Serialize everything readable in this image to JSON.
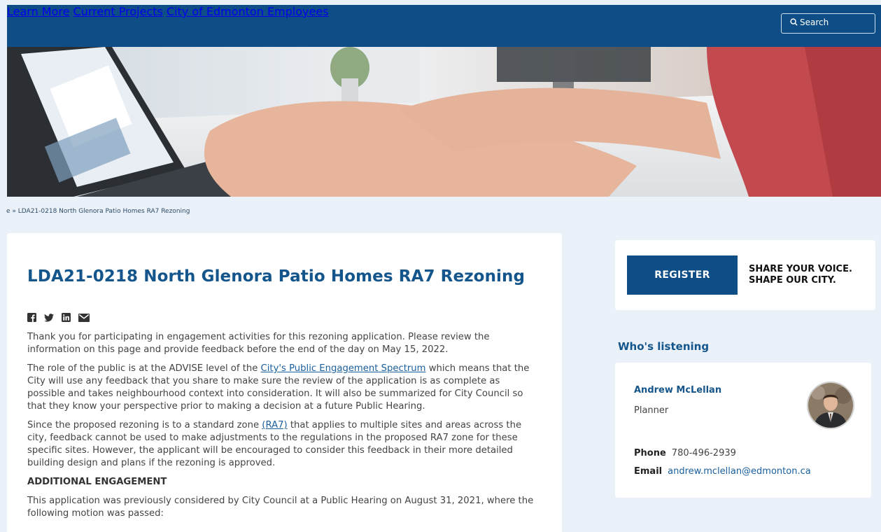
{
  "nav": {
    "learn_more": "Learn More",
    "current_projects": "Current Projects",
    "employees": "City of Edmonton Employees",
    "search_label": "Search"
  },
  "breadcrumb": "e » LDA21-0218 North Glenora Patio Homes RA7 Rezoning",
  "page": {
    "title": "LDA21-0218 North Glenora Patio Homes RA7 Rezoning",
    "p1": "Thank you for participating in engagement activities for this rezoning application. Please review the information on this page and provide feedback before the end of the day on May 15, 2022.",
    "p2_before": "The role of the public is at the ADVISE level of the ",
    "p2_link": "City's Public Engagement Spectrum",
    "p2_after": " which means that the City will use any feedback that you share to make sure the review of the application is as complete as possible and takes neighbourhood context into consideration. It will also be summarized for City Council so that they know your perspective prior to making a decision at a future Public Hearing.",
    "p3_before": "Since the proposed rezoning is to a standard zone ",
    "p3_link": "(RA7)",
    "p3_after": " that applies to multiple sites and areas across the city, feedback cannot be used to make adjustments to the regulations in the proposed RA7 zone for these specific sites. However, the applicant will be encouraged to consider this feedback in their more detailed building design and plans if the rezoning is approved.",
    "subheading": "ADDITIONAL ENGAGEMENT",
    "p4": "This application was previously considered by City Council at a Public Hearing on August 31, 2021, where the following motion was passed:"
  },
  "register": {
    "button": "REGISTER",
    "slogan_line1": "SHARE YOUR VOICE.",
    "slogan_line2": "SHAPE OUR CITY."
  },
  "listening": {
    "heading": "Who's listening",
    "name": "Andrew McLellan",
    "role": "Planner",
    "phone_label": "Phone",
    "phone": "780-496-2939",
    "email_label": "Email",
    "email": "andrew.mclellan@edmonton.ca"
  },
  "colors": {
    "brand_blue": "#0e4d85",
    "title_blue": "#14558c",
    "page_bg": "#eaf1f8"
  },
  "icons": [
    "facebook-icon",
    "twitter-icon",
    "linkedin-icon",
    "email-icon",
    "search-icon"
  ]
}
